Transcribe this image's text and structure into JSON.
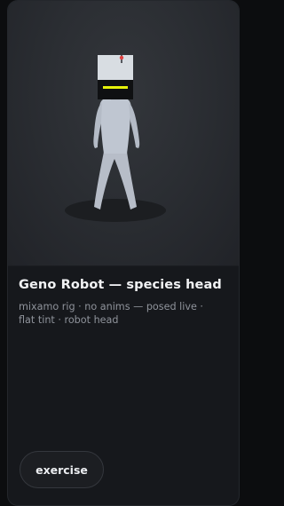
{
  "card": {
    "title": "Geno Robot — species head",
    "description": "mixamo rig · no anims — posed live · flat tint · robot head",
    "action_label": "exercise"
  },
  "preview": {
    "model_color": "#b9c0cc",
    "head_screen_color": "#d8dde2",
    "visor_accent": "#e6f20a",
    "antenna_tip": "#e04040",
    "icon": "robot-figure"
  }
}
